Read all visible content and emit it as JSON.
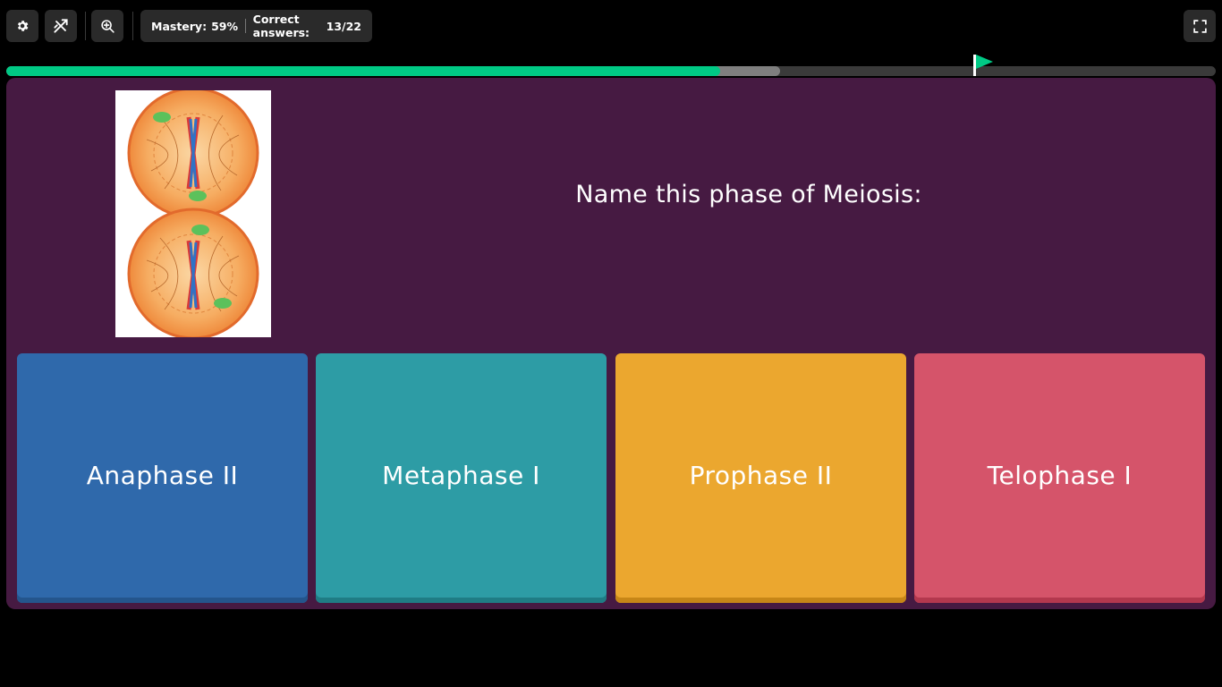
{
  "toolbar": {
    "settings_icon": "gear-icon",
    "powerups_icon": "no-powerups-icon",
    "zoom_icon": "zoom-in-icon",
    "fullscreen_icon": "fullscreen-icon"
  },
  "stats": {
    "mastery_label": "Mastery:",
    "mastery_value": "59%",
    "correct_label": "Correct answers:",
    "correct_value": "13/22"
  },
  "progress": {
    "completed_fraction": 0.59,
    "pending_fraction": 0.64,
    "target_fraction": 0.8,
    "fill_color": "#00c985"
  },
  "question": {
    "image_description": "meiosis-cells-icon",
    "text": "Name this phase of Meiosis:"
  },
  "options": [
    {
      "label": "Anaphase II",
      "color": "#2f69ab",
      "shadow": "#24558c"
    },
    {
      "label": "Metaphase I",
      "color": "#2d9ca5",
      "shadow": "#1f7c84"
    },
    {
      "label": "Prophase II",
      "color": "#eba72f",
      "shadow": "#c68617"
    },
    {
      "label": "Telophase I",
      "color": "#d5546a",
      "shadow": "#b3384e"
    }
  ],
  "colors": {
    "background": "#000000",
    "panel": "#461a42"
  }
}
